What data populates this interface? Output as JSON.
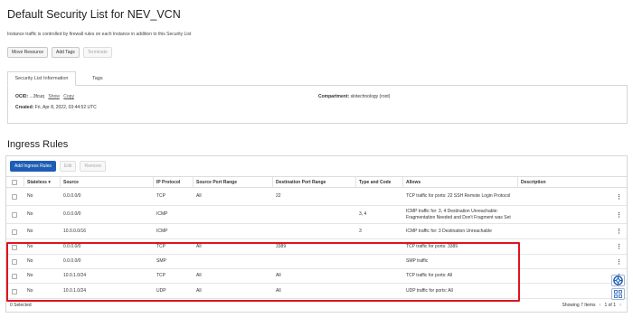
{
  "page": {
    "title": "Default Security List for NEV_VCN",
    "description": "Instance traffic is controlled by firewall rules on each Instance in addition to this Security List"
  },
  "actions": {
    "move_resource": "Move Resource",
    "add_tags": "Add Tags",
    "terminate": "Terminate"
  },
  "tabs": {
    "info": "Security List Information",
    "tags": "Tags"
  },
  "info": {
    "ocid_label": "OCID:",
    "ocid_value": "...3fcuq",
    "show": "Show",
    "copy": "Copy",
    "compartment_label": "Compartment:",
    "compartment_value": "slotechnology (root)",
    "created_label": "Created:",
    "created_value": "Fri, Apr 8, 2022, 03:44:52 UTC"
  },
  "ingress": {
    "title": "Ingress Rules",
    "add_button": "Add Ingress Rules",
    "edit_button": "Edit",
    "remove_button": "Remove",
    "columns": {
      "stateless": "Stateless",
      "stateless_arrow": "▾",
      "source": "Source",
      "ip_protocol": "IP Protocol",
      "source_port": "Source Port Range",
      "dest_port": "Destination Port Range",
      "type_code": "Type and Code",
      "allows": "Allows",
      "description": "Description"
    },
    "rows": [
      {
        "stateless": "No",
        "source": "0.0.0.0/0",
        "protocol": "TCP",
        "src_port": "All",
        "dst_port": "22",
        "type_code": "",
        "allows": "TCP traffic for ports: 22 SSH Remote Login Protocol"
      },
      {
        "stateless": "No",
        "source": "0.0.0.0/0",
        "protocol": "ICMP",
        "src_port": "",
        "dst_port": "",
        "type_code": "3, 4",
        "allows": "ICMP traffic for: 3, 4 Destination Unreachable: Fragmentation Needed and Don't Fragment was Set"
      },
      {
        "stateless": "No",
        "source": "10.0.0.0/16",
        "protocol": "ICMP",
        "src_port": "",
        "dst_port": "",
        "type_code": "3",
        "allows": "ICMP traffic for: 3 Destination Unreachable"
      },
      {
        "stateless": "No",
        "source": "0.0.0.0/0",
        "protocol": "TCP",
        "src_port": "All",
        "dst_port": "3389",
        "type_code": "",
        "allows": "TCP traffic for ports: 3389"
      },
      {
        "stateless": "No",
        "source": "0.0.0.0/0",
        "protocol": "SMP",
        "src_port": "",
        "dst_port": "",
        "type_code": "",
        "allows": "SMP traffic"
      },
      {
        "stateless": "No",
        "source": "10.0.1.0/24",
        "protocol": "TCP",
        "src_port": "All",
        "dst_port": "All",
        "type_code": "",
        "allows": "TCP traffic for ports: All"
      },
      {
        "stateless": "No",
        "source": "10.0.1.0/24",
        "protocol": "UDP",
        "src_port": "All",
        "dst_port": "All",
        "type_code": "",
        "allows": "UDP traffic for ports: All"
      }
    ],
    "selected_text": "0 Selected",
    "showing_text": "Showing 7 Items",
    "page_text": "1 of 1",
    "prev": "‹",
    "next": "›",
    "kebab": "⋮"
  },
  "colors": {
    "primary": "#1f5db4",
    "highlight": "#e0141e"
  },
  "icons": {
    "help": "lifebuoy-icon",
    "grid": "grid-icon"
  }
}
